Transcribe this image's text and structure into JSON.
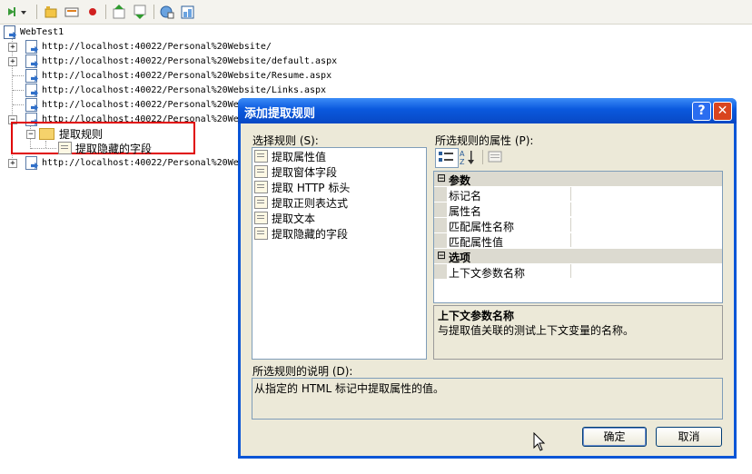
{
  "toolbar": {
    "buttons": [
      "add-request-icon",
      "add-folder-icon",
      "add-comment-icon",
      "stop-icon",
      "move-up-icon",
      "move-down-icon",
      "parameterize-icon",
      "properties-icon"
    ]
  },
  "tree": {
    "root_label": "WebTest1",
    "requests": [
      "http://localhost:40022/Personal%20Website/",
      "http://localhost:40022/Personal%20Website/default.aspx",
      "http://localhost:40022/Personal%20Website/Resume.aspx",
      "http://localhost:40022/Personal%20Website/Links.aspx",
      "http://localhost:40022/Personal%20We",
      "http://localhost:40022/Personal%20We"
    ],
    "last_request": "http://localhost:40022/Personal%20We",
    "folder_label": "提取规则",
    "child_label": "提取隐藏的字段",
    "highlight_color": "#e00000"
  },
  "dialog": {
    "title": "添加提取规则",
    "help_label": "?",
    "close_label": "✕",
    "rules_label": "选择规则 (S):",
    "rules": [
      "提取属性值",
      "提取窗体字段",
      "提取 HTTP 标头",
      "提取正则表达式",
      "提取文本",
      "提取隐藏的字段"
    ],
    "props_label": "所选规则的属性 (P):",
    "categories": [
      {
        "name": "参数",
        "props": [
          "标记名",
          "属性名",
          "匹配属性名称",
          "匹配属性值"
        ]
      },
      {
        "name": "选项",
        "props": [
          "上下文参数名称"
        ]
      }
    ],
    "help_title": "上下文参数名称",
    "help_text": "与提取值关联的测试上下文变量的名称。",
    "desc_label": "所选规则的说明 (D):",
    "desc_text": "从指定的 HTML 标记中提取属性的值。",
    "ok_label": "确定",
    "cancel_label": "取消"
  },
  "colors": {
    "titlebar": "#0a58dd",
    "dialog_bg": "#ece9d8",
    "border": "#7f9db9"
  }
}
